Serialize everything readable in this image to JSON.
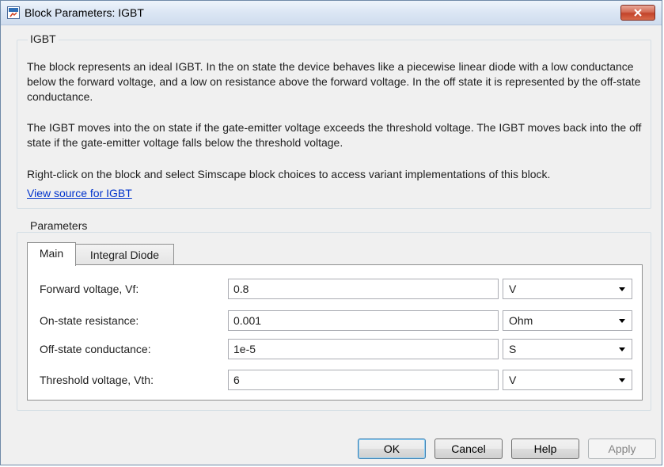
{
  "window": {
    "title": "Block Parameters: IGBT"
  },
  "block": {
    "section_title": "IGBT",
    "paragraphs": [
      "The block represents an ideal IGBT. In the on state the device behaves like a piecewise linear diode with a low conductance below the forward voltage, and a low on resistance above the forward voltage. In the off state it is represented by the off-state conductance.",
      "The IGBT moves into the on state if the gate-emitter voltage exceeds the threshold voltage. The IGBT moves back into the off state if the gate-emitter voltage falls below the threshold voltage.",
      "Right-click on the block and select Simscape block choices to access variant implementations of this block."
    ],
    "source_link": "View source for IGBT"
  },
  "parameters": {
    "section_title": "Parameters",
    "tabs": [
      {
        "label": "Main",
        "active": true
      },
      {
        "label": "Integral Diode",
        "active": false
      }
    ],
    "rows": [
      {
        "label": "Forward voltage, Vf:",
        "value": "0.8",
        "unit": "V"
      },
      {
        "label": "On-state resistance:",
        "value": "0.001",
        "unit": "Ohm"
      },
      {
        "label": "Off-state conductance:",
        "value": "1e-5",
        "unit": "S"
      },
      {
        "label": "Threshold voltage, Vth:",
        "value": "6",
        "unit": "V"
      }
    ]
  },
  "buttons": {
    "ok": "OK",
    "cancel": "Cancel",
    "help": "Help",
    "apply": "Apply"
  },
  "icons": {
    "title": "simulink-block-icon",
    "close": "close-icon",
    "dropdown": "chevron-down-icon"
  },
  "colors": {
    "link": "#0033cc",
    "close_button": "#c3432a",
    "default_button_border": "#3c7fb1"
  }
}
